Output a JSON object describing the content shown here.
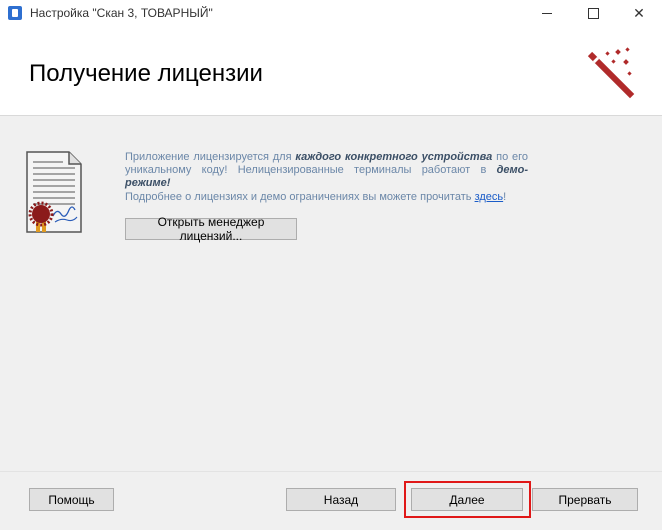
{
  "window": {
    "title": "Настройка \"Скан 3, ТОВАРНЫЙ\"",
    "minimize_glyph": "—",
    "close_glyph": "✕"
  },
  "header": {
    "title": "Получение лицензии",
    "icon": "magic-wand-icon"
  },
  "content": {
    "icon": "license-certificate-icon",
    "info_part1": "Приложение лицензируется для ",
    "info_bold1": "каждого конкретного устройства",
    "info_part2": " по его уникальному коду! Нелицензированные терминалы работают в ",
    "info_bold2": "демо-режиме!",
    "info_line2_part1": "Подробнее о лицензиях и демо ограничениях вы можете прочитать ",
    "info_link": "здесь",
    "info_line2_end": "!",
    "open_manager_button": "Открыть менеджер лицензий..."
  },
  "footer": {
    "help_button": "Помощь",
    "back_button": "Назад",
    "next_button": "Далее",
    "abort_button": "Прервать"
  },
  "colors": {
    "highlight": "#e01818",
    "wand": "#b02a2a",
    "seal": "#8b1a1a"
  }
}
